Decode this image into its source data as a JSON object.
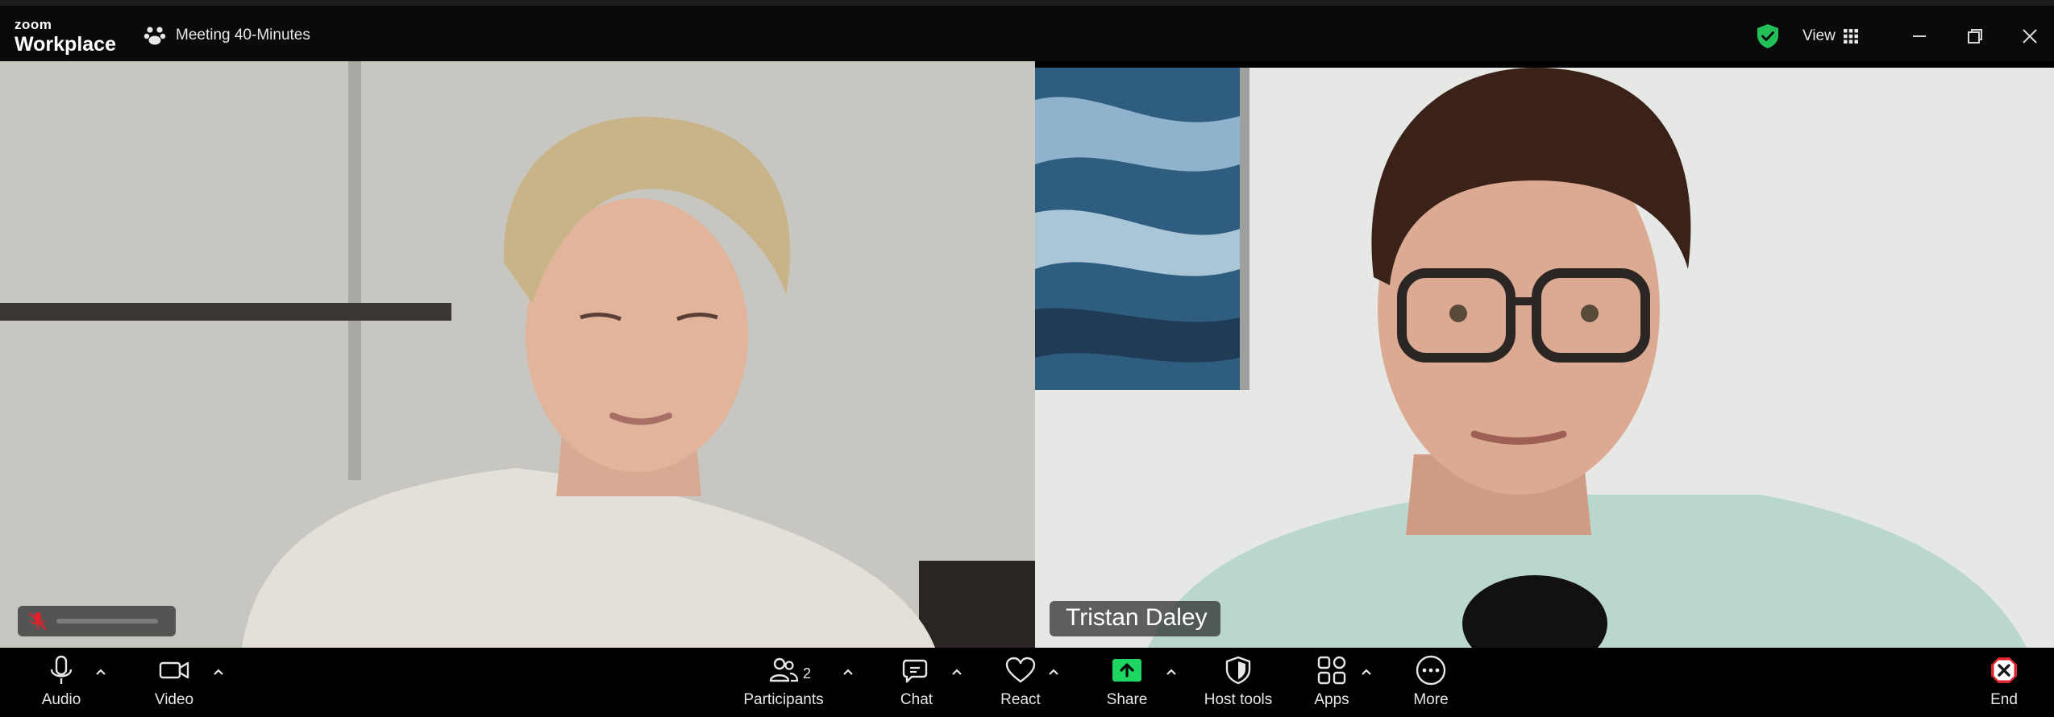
{
  "window": {
    "brand_top": "zoom",
    "brand_bottom": "Workplace",
    "meeting_title": "Meeting 40-Minutes",
    "view_label": "View"
  },
  "participants_tiles": [
    {
      "name": ""
    },
    {
      "name": "Tristan Daley"
    }
  ],
  "toolbar": {
    "audio_label": "Audio",
    "video_label": "Video",
    "participants_label": "Participants",
    "participants_count": "2",
    "chat_label": "Chat",
    "react_label": "React",
    "share_label": "Share",
    "host_tools_label": "Host tools",
    "apps_label": "Apps",
    "more_label": "More",
    "end_label": "End"
  },
  "colors": {
    "share_accent": "#1ed760",
    "security_green": "#23c05a",
    "end_red": "#e0212e",
    "toolbar_bg": "#000000"
  },
  "icons": {
    "meeting": "meeting-paw-icon",
    "security": "shield-check-icon",
    "view": "grid-icon",
    "audio": "microphone-icon",
    "video": "video-camera-icon",
    "participants": "people-icon",
    "chat": "chat-bubble-icon",
    "react": "heart-icon",
    "share": "share-arrow-icon",
    "host_tools": "shield-icon",
    "apps": "apps-icon",
    "more": "ellipsis-icon",
    "end": "end-x-icon"
  }
}
